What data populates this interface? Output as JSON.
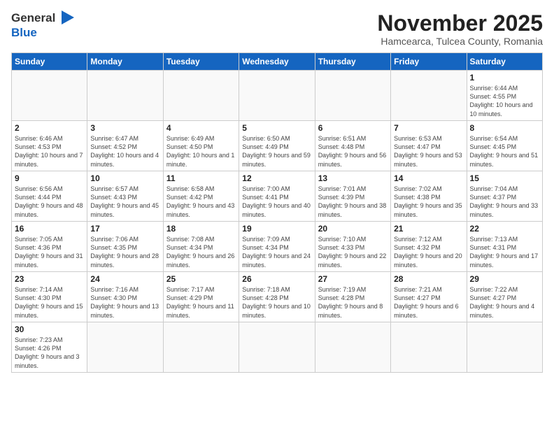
{
  "logo": {
    "line1": "General",
    "line2": "Blue"
  },
  "title": "November 2025",
  "subtitle": "Hamcearca, Tulcea County, Romania",
  "weekdays": [
    "Sunday",
    "Monday",
    "Tuesday",
    "Wednesday",
    "Thursday",
    "Friday",
    "Saturday"
  ],
  "weeks": [
    [
      {
        "day": "",
        "info": ""
      },
      {
        "day": "",
        "info": ""
      },
      {
        "day": "",
        "info": ""
      },
      {
        "day": "",
        "info": ""
      },
      {
        "day": "",
        "info": ""
      },
      {
        "day": "",
        "info": ""
      },
      {
        "day": "1",
        "info": "Sunrise: 6:44 AM\nSunset: 4:55 PM\nDaylight: 10 hours and 10 minutes."
      }
    ],
    [
      {
        "day": "2",
        "info": "Sunrise: 6:46 AM\nSunset: 4:53 PM\nDaylight: 10 hours and 7 minutes."
      },
      {
        "day": "3",
        "info": "Sunrise: 6:47 AM\nSunset: 4:52 PM\nDaylight: 10 hours and 4 minutes."
      },
      {
        "day": "4",
        "info": "Sunrise: 6:49 AM\nSunset: 4:50 PM\nDaylight: 10 hours and 1 minute."
      },
      {
        "day": "5",
        "info": "Sunrise: 6:50 AM\nSunset: 4:49 PM\nDaylight: 9 hours and 59 minutes."
      },
      {
        "day": "6",
        "info": "Sunrise: 6:51 AM\nSunset: 4:48 PM\nDaylight: 9 hours and 56 minutes."
      },
      {
        "day": "7",
        "info": "Sunrise: 6:53 AM\nSunset: 4:47 PM\nDaylight: 9 hours and 53 minutes."
      },
      {
        "day": "8",
        "info": "Sunrise: 6:54 AM\nSunset: 4:45 PM\nDaylight: 9 hours and 51 minutes."
      }
    ],
    [
      {
        "day": "9",
        "info": "Sunrise: 6:56 AM\nSunset: 4:44 PM\nDaylight: 9 hours and 48 minutes."
      },
      {
        "day": "10",
        "info": "Sunrise: 6:57 AM\nSunset: 4:43 PM\nDaylight: 9 hours and 45 minutes."
      },
      {
        "day": "11",
        "info": "Sunrise: 6:58 AM\nSunset: 4:42 PM\nDaylight: 9 hours and 43 minutes."
      },
      {
        "day": "12",
        "info": "Sunrise: 7:00 AM\nSunset: 4:41 PM\nDaylight: 9 hours and 40 minutes."
      },
      {
        "day": "13",
        "info": "Sunrise: 7:01 AM\nSunset: 4:39 PM\nDaylight: 9 hours and 38 minutes."
      },
      {
        "day": "14",
        "info": "Sunrise: 7:02 AM\nSunset: 4:38 PM\nDaylight: 9 hours and 35 minutes."
      },
      {
        "day": "15",
        "info": "Sunrise: 7:04 AM\nSunset: 4:37 PM\nDaylight: 9 hours and 33 minutes."
      }
    ],
    [
      {
        "day": "16",
        "info": "Sunrise: 7:05 AM\nSunset: 4:36 PM\nDaylight: 9 hours and 31 minutes."
      },
      {
        "day": "17",
        "info": "Sunrise: 7:06 AM\nSunset: 4:35 PM\nDaylight: 9 hours and 28 minutes."
      },
      {
        "day": "18",
        "info": "Sunrise: 7:08 AM\nSunset: 4:34 PM\nDaylight: 9 hours and 26 minutes."
      },
      {
        "day": "19",
        "info": "Sunrise: 7:09 AM\nSunset: 4:34 PM\nDaylight: 9 hours and 24 minutes."
      },
      {
        "day": "20",
        "info": "Sunrise: 7:10 AM\nSunset: 4:33 PM\nDaylight: 9 hours and 22 minutes."
      },
      {
        "day": "21",
        "info": "Sunrise: 7:12 AM\nSunset: 4:32 PM\nDaylight: 9 hours and 20 minutes."
      },
      {
        "day": "22",
        "info": "Sunrise: 7:13 AM\nSunset: 4:31 PM\nDaylight: 9 hours and 17 minutes."
      }
    ],
    [
      {
        "day": "23",
        "info": "Sunrise: 7:14 AM\nSunset: 4:30 PM\nDaylight: 9 hours and 15 minutes."
      },
      {
        "day": "24",
        "info": "Sunrise: 7:16 AM\nSunset: 4:30 PM\nDaylight: 9 hours and 13 minutes."
      },
      {
        "day": "25",
        "info": "Sunrise: 7:17 AM\nSunset: 4:29 PM\nDaylight: 9 hours and 11 minutes."
      },
      {
        "day": "26",
        "info": "Sunrise: 7:18 AM\nSunset: 4:28 PM\nDaylight: 9 hours and 10 minutes."
      },
      {
        "day": "27",
        "info": "Sunrise: 7:19 AM\nSunset: 4:28 PM\nDaylight: 9 hours and 8 minutes."
      },
      {
        "day": "28",
        "info": "Sunrise: 7:21 AM\nSunset: 4:27 PM\nDaylight: 9 hours and 6 minutes."
      },
      {
        "day": "29",
        "info": "Sunrise: 7:22 AM\nSunset: 4:27 PM\nDaylight: 9 hours and 4 minutes."
      }
    ],
    [
      {
        "day": "30",
        "info": "Sunrise: 7:23 AM\nSunset: 4:26 PM\nDaylight: 9 hours and 3 minutes."
      },
      {
        "day": "",
        "info": ""
      },
      {
        "day": "",
        "info": ""
      },
      {
        "day": "",
        "info": ""
      },
      {
        "day": "",
        "info": ""
      },
      {
        "day": "",
        "info": ""
      },
      {
        "day": "",
        "info": ""
      }
    ]
  ]
}
